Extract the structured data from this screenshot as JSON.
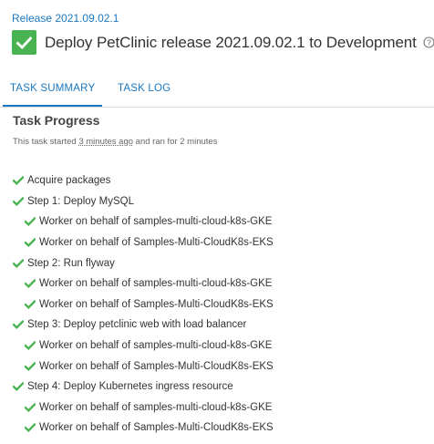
{
  "header": {
    "breadcrumb": "Release 2021.09.02.1",
    "title": "Deploy PetClinic release 2021.09.02.1 to Development",
    "status_color": "#48b350",
    "status_icon": "check-icon",
    "help_icon": "question-circle-icon"
  },
  "tabs": [
    {
      "label": "TASK SUMMARY",
      "active": true
    },
    {
      "label": "TASK LOG",
      "active": false
    }
  ],
  "progress": {
    "title": "Task Progress",
    "started_prefix": "This task started ",
    "started_ago": "3 minutes ago",
    "started_suffix": " and ran for 2 minutes"
  },
  "colors": {
    "accent": "#1a78c2",
    "success": "#48b350"
  },
  "tasks": [
    {
      "level": 0,
      "label": "Acquire packages",
      "status": "success"
    },
    {
      "level": 0,
      "label": "Step 1: Deploy MySQL",
      "status": "success"
    },
    {
      "level": 1,
      "label": "Worker on behalf of samples-multi-cloud-k8s-GKE",
      "status": "success"
    },
    {
      "level": 1,
      "label": "Worker on behalf of Samples-Multi-CloudK8s-EKS",
      "status": "success"
    },
    {
      "level": 0,
      "label": "Step 2: Run flyway",
      "status": "success"
    },
    {
      "level": 1,
      "label": "Worker on behalf of samples-multi-cloud-k8s-GKE",
      "status": "success"
    },
    {
      "level": 1,
      "label": "Worker on behalf of Samples-Multi-CloudK8s-EKS",
      "status": "success"
    },
    {
      "level": 0,
      "label": "Step 3: Deploy petclinic web with load balancer",
      "status": "success"
    },
    {
      "level": 1,
      "label": "Worker on behalf of samples-multi-cloud-k8s-GKE",
      "status": "success"
    },
    {
      "level": 1,
      "label": "Worker on behalf of Samples-Multi-CloudK8s-EKS",
      "status": "success"
    },
    {
      "level": 0,
      "label": "Step 4: Deploy Kubernetes ingress resource",
      "status": "success"
    },
    {
      "level": 1,
      "label": "Worker on behalf of samples-multi-cloud-k8s-GKE",
      "status": "success"
    },
    {
      "level": 1,
      "label": "Worker on behalf of Samples-Multi-CloudK8s-EKS",
      "status": "success"
    }
  ]
}
